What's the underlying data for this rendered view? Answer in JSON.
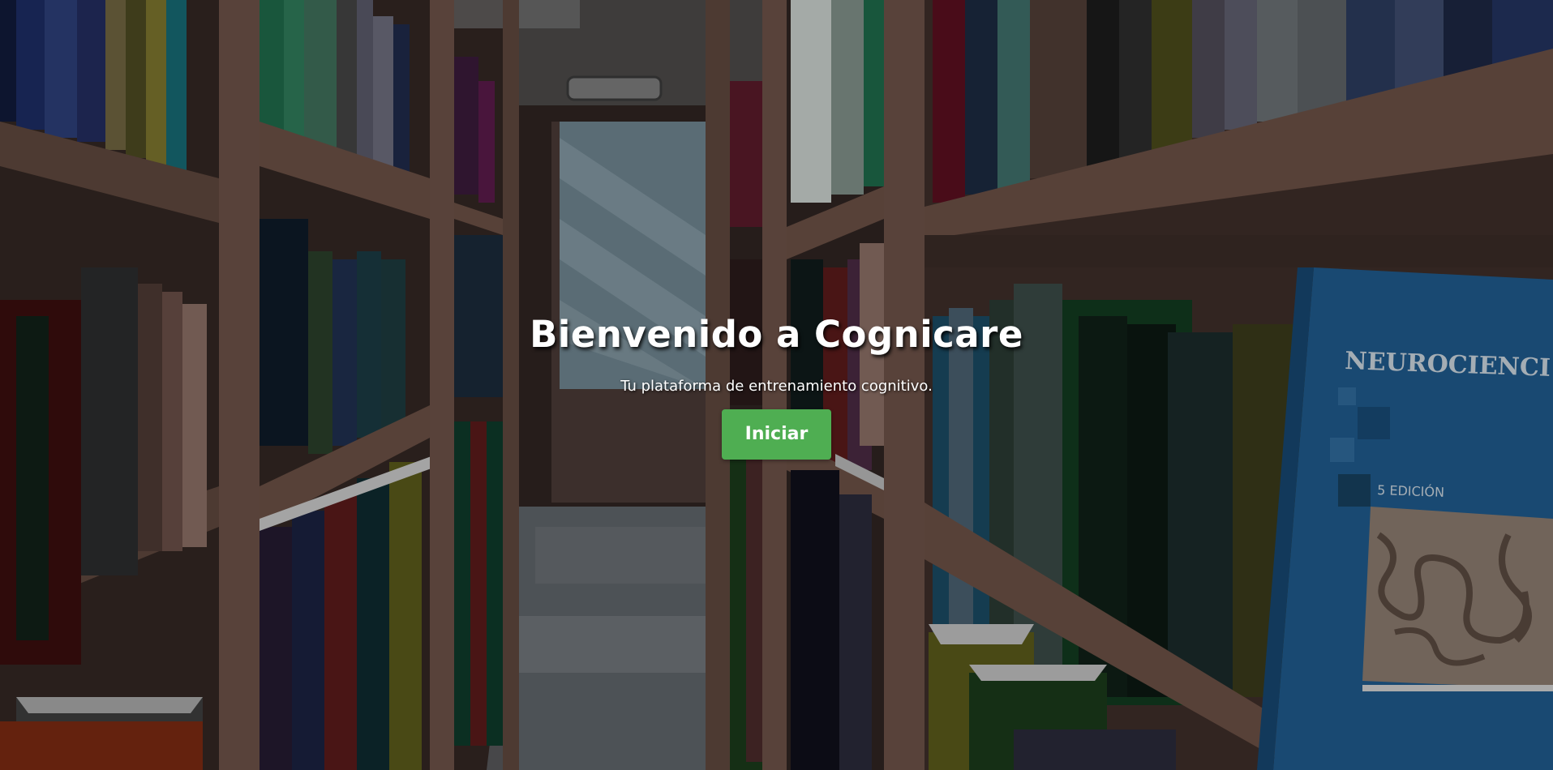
{
  "hero": {
    "title": "Bienvenido a Cognicare",
    "subtitle": "Tu plataforma de entrenamiento cognitivo.",
    "start_label": "Iniciar"
  },
  "background": {
    "book_spine_title": "NEUROCIENCI",
    "book_edition": "5 EDICIÓN"
  },
  "colors": {
    "button": "#4fae52",
    "text": "#ffffff",
    "shelf_wood": "#6b4f43",
    "book_blue": "#1f5a8c"
  }
}
